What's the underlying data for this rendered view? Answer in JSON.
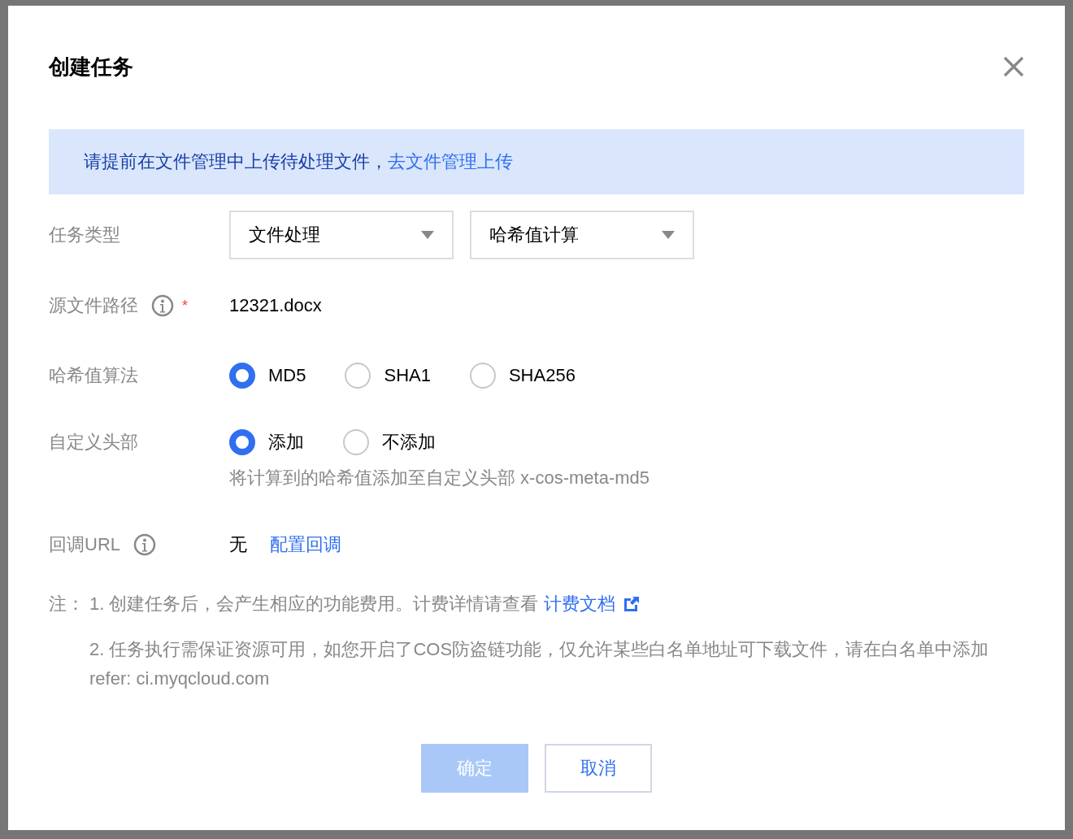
{
  "dialog": {
    "title": "创建任务"
  },
  "notice": {
    "text": "请提前在文件管理中上传待处理文件，",
    "link": "去文件管理上传"
  },
  "fields": [
    {
      "kind": "selects",
      "label": "任务类型",
      "info": false,
      "selects": [
        {
          "value": "文件处理"
        },
        {
          "value": "哈希值计算"
        }
      ]
    },
    {
      "kind": "text",
      "label": "源文件路径",
      "info": true,
      "required_mark": "*",
      "value": "12321.docx"
    },
    {
      "kind": "radios",
      "label": "哈希值算法",
      "info": false,
      "options": [
        {
          "label": "MD5",
          "selected": true
        },
        {
          "label": "SHA1",
          "selected": false
        },
        {
          "label": "SHA256",
          "selected": false
        }
      ]
    },
    {
      "kind": "radios",
      "label": "自定义头部",
      "info": false,
      "options": [
        {
          "label": "添加",
          "selected": true
        },
        {
          "label": "不添加",
          "selected": false
        }
      ],
      "hint": "将计算到的哈希值添加至自定义头部 x-cos-meta-md5"
    },
    {
      "kind": "link",
      "label": "回调URL",
      "info": true,
      "value": "无",
      "link": "配置回调"
    }
  ],
  "notes": {
    "label": "注：",
    "items": [
      {
        "text": "1. 创建任务后，会产生相应的功能费用。计费详情请查看 ",
        "link": "计费文档"
      },
      {
        "text": "2. 任务执行需保证资源可用，如您开启了COS防盗链功能，仅允许某些白名单地址可下载文件，请在白名单中添加refer: ci.myqcloud.com"
      }
    ]
  },
  "buttons": [
    {
      "label": "确定",
      "kind": "primary",
      "disabled": true
    },
    {
      "label": "取消",
      "kind": "secondary",
      "disabled": false
    }
  ]
}
